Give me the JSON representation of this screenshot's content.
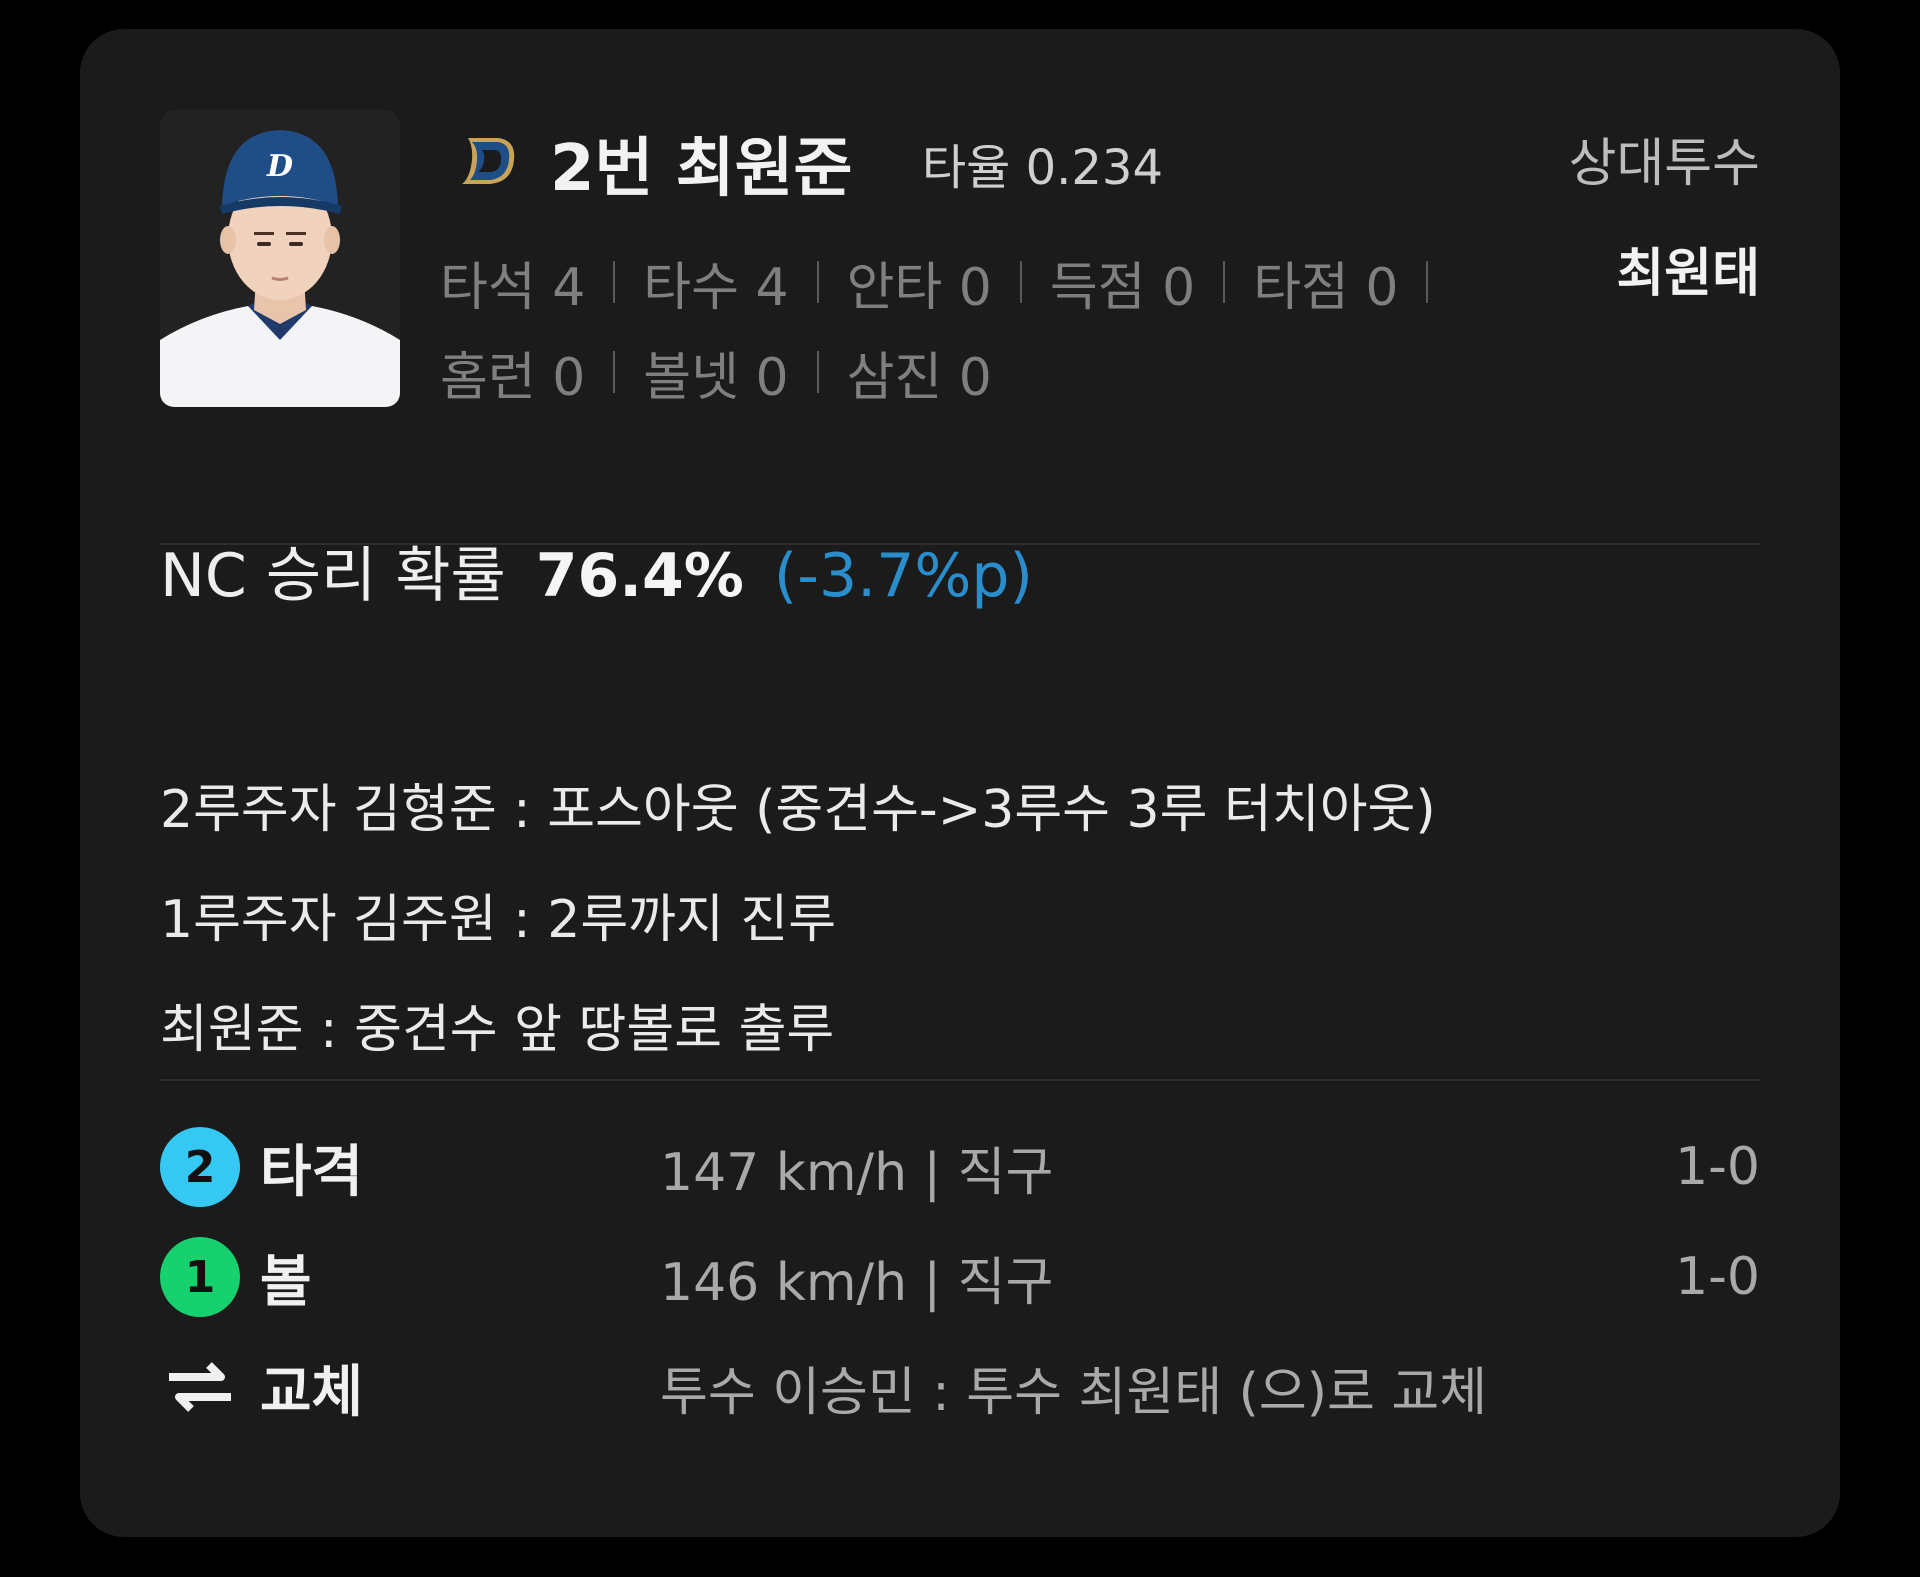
{
  "batter": {
    "team_logo": "nc-dinos-logo",
    "name": "2번 최원준",
    "avg": "타율 0.234",
    "stats_row1": [
      "타석 4",
      "타수 4",
      "안타 0",
      "득점 0",
      "타점 0"
    ],
    "stats_row2": [
      "홈런 0",
      "볼넷 0",
      "삼진 0"
    ]
  },
  "pitcher": {
    "label": "상대투수",
    "name": "최원태"
  },
  "win_prob": {
    "label": "NC 승리 확률",
    "value": "76.4%",
    "delta": "(-3.7%p)",
    "delta_color": "#2a8dcc"
  },
  "plays": [
    "2루주자 김형준 : 포스아웃 (중견수->3루수 3루 터치아웃)",
    "1루주자 김주원 : 2루까지 진루",
    "최원준 : 중견수 앞 땅볼로 출루"
  ],
  "pitches": [
    {
      "badge": "2",
      "badge_color": "#35c8f2",
      "type": "타격",
      "desc": "147 km/h | 직구",
      "count": "1-0"
    },
    {
      "badge": "1",
      "badge_color": "#17d16f",
      "type": "볼",
      "desc": "146 km/h | 직구",
      "count": "1-0"
    },
    {
      "icon": "swap-arrows-icon",
      "type": "교체",
      "desc": "투수 이승민 : 투수 최원태 (으)로 교체",
      "count": ""
    }
  ]
}
